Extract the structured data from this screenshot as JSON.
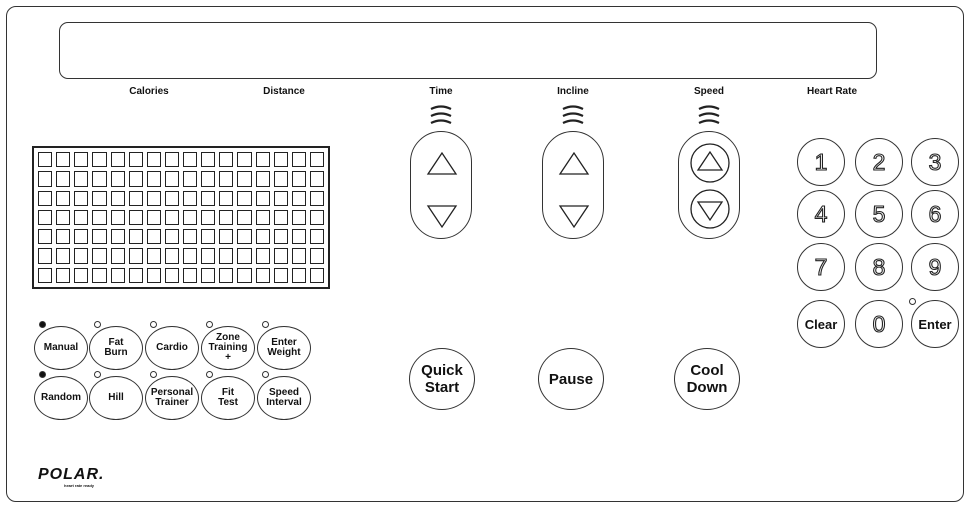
{
  "display": {
    "labels": {
      "calories": "Calories",
      "distance": "Distance",
      "time": "Time",
      "incline": "Incline",
      "speed": "Speed",
      "heart_rate": "Heart Rate"
    }
  },
  "programs": {
    "row1": [
      "Manual",
      "Fat\nBurn",
      "Cardio",
      "Zone\nTraining\n+",
      "Enter\nWeight"
    ],
    "row2": [
      "Random",
      "Hill",
      "Personal\nTrainer",
      "Fit\nTest",
      "Speed\nInterval"
    ],
    "active_row1": [
      true,
      false,
      false,
      false,
      false
    ],
    "active_row2": [
      true,
      false,
      false,
      false,
      false
    ]
  },
  "controls": {
    "quick_start": "Quick\nStart",
    "pause": "Pause",
    "cool_down": "Cool\nDown"
  },
  "keypad": {
    "rows": [
      [
        "1",
        "2",
        "3"
      ],
      [
        "4",
        "5",
        "6"
      ],
      [
        "7",
        "8",
        "9"
      ]
    ],
    "clear": "Clear",
    "zero": "0",
    "enter": "Enter"
  },
  "brand": {
    "logo": "POLAR.",
    "tagline": "heart rate ready"
  }
}
